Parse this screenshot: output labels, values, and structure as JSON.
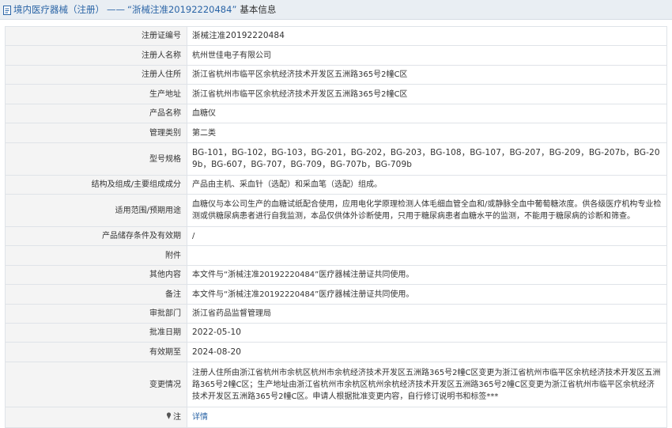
{
  "header": {
    "section_label": "境内医疗器械（注册）",
    "separator": "——",
    "record_title": "“浙械注准20192220484”",
    "suffix": "基本信息",
    "icon": "document-icon"
  },
  "rows": [
    {
      "label": "注册证编号",
      "value": "浙械注准20192220484"
    },
    {
      "label": "注册人名称",
      "value": "杭州世佳电子有限公司"
    },
    {
      "label": "注册人住所",
      "value": "浙江省杭州市临平区余杭经济技术开发区五洲路365号2幢C区"
    },
    {
      "label": "生产地址",
      "value": "浙江省杭州市临平区余杭经济技术开发区五洲路365号2幢C区"
    },
    {
      "label": "产品名称",
      "value": "血糖仪"
    },
    {
      "label": "管理类别",
      "value": "第二类"
    },
    {
      "label": "型号规格",
      "value": "BG-101，BG-102，BG-103，BG-201，BG-202，BG-203，BG-108，BG-107，BG-207，BG-209，BG-207b，BG-209b，BG-607，BG-707，BG-709，BG-707b，BG-709b"
    },
    {
      "label": "结构及组成/主要组成成分",
      "value": "产品由主机、采血针（选配）和采血笔（选配）组成。"
    },
    {
      "label": "适用范围/预期用途",
      "value": "血糖仪与本公司生产的血糖试纸配合使用，应用电化学原理检测人体毛细血管全血和/或静脉全血中葡萄糖浓度。供各级医疗机构专业检测或供糖尿病患者进行自我监测，本品仅供体外诊断使用，只用于糖尿病患者血糖水平的监测，不能用于糖尿病的诊断和筛查。"
    },
    {
      "label": "产品储存条件及有效期",
      "value": "/"
    },
    {
      "label": "附件",
      "value": ""
    },
    {
      "label": "其他内容",
      "value": "本文件与“浙械注准20192220484”医疗器械注册证共同使用。"
    },
    {
      "label": "备注",
      "value": "本文件与“浙械注准20192220484”医疗器械注册证共同使用。"
    },
    {
      "label": "审批部门",
      "value": "浙江省药品监督管理局"
    },
    {
      "label": "批准日期",
      "value": "2022-05-10"
    },
    {
      "label": "有效期至",
      "value": "2024-08-20"
    },
    {
      "label": "变更情况",
      "value": "注册人住所由浙江省杭州市余杭区杭州市余杭经济技术开发区五洲路365号2幢C区变更为浙江省杭州市临平区余杭经济技术开发区五洲路365号2幢C区；生产地址由浙江省杭州市余杭区杭州余杭经济技术开发区五洲路365号2幢C区变更为浙江省杭州市临平区余杭经济技术开发区五洲路365号2幢C区。申请人根据批准变更内容，自行修订说明书和标签***"
    }
  ],
  "note_row": {
    "label": "注",
    "icon": "pin-icon",
    "link_text": "详情"
  }
}
